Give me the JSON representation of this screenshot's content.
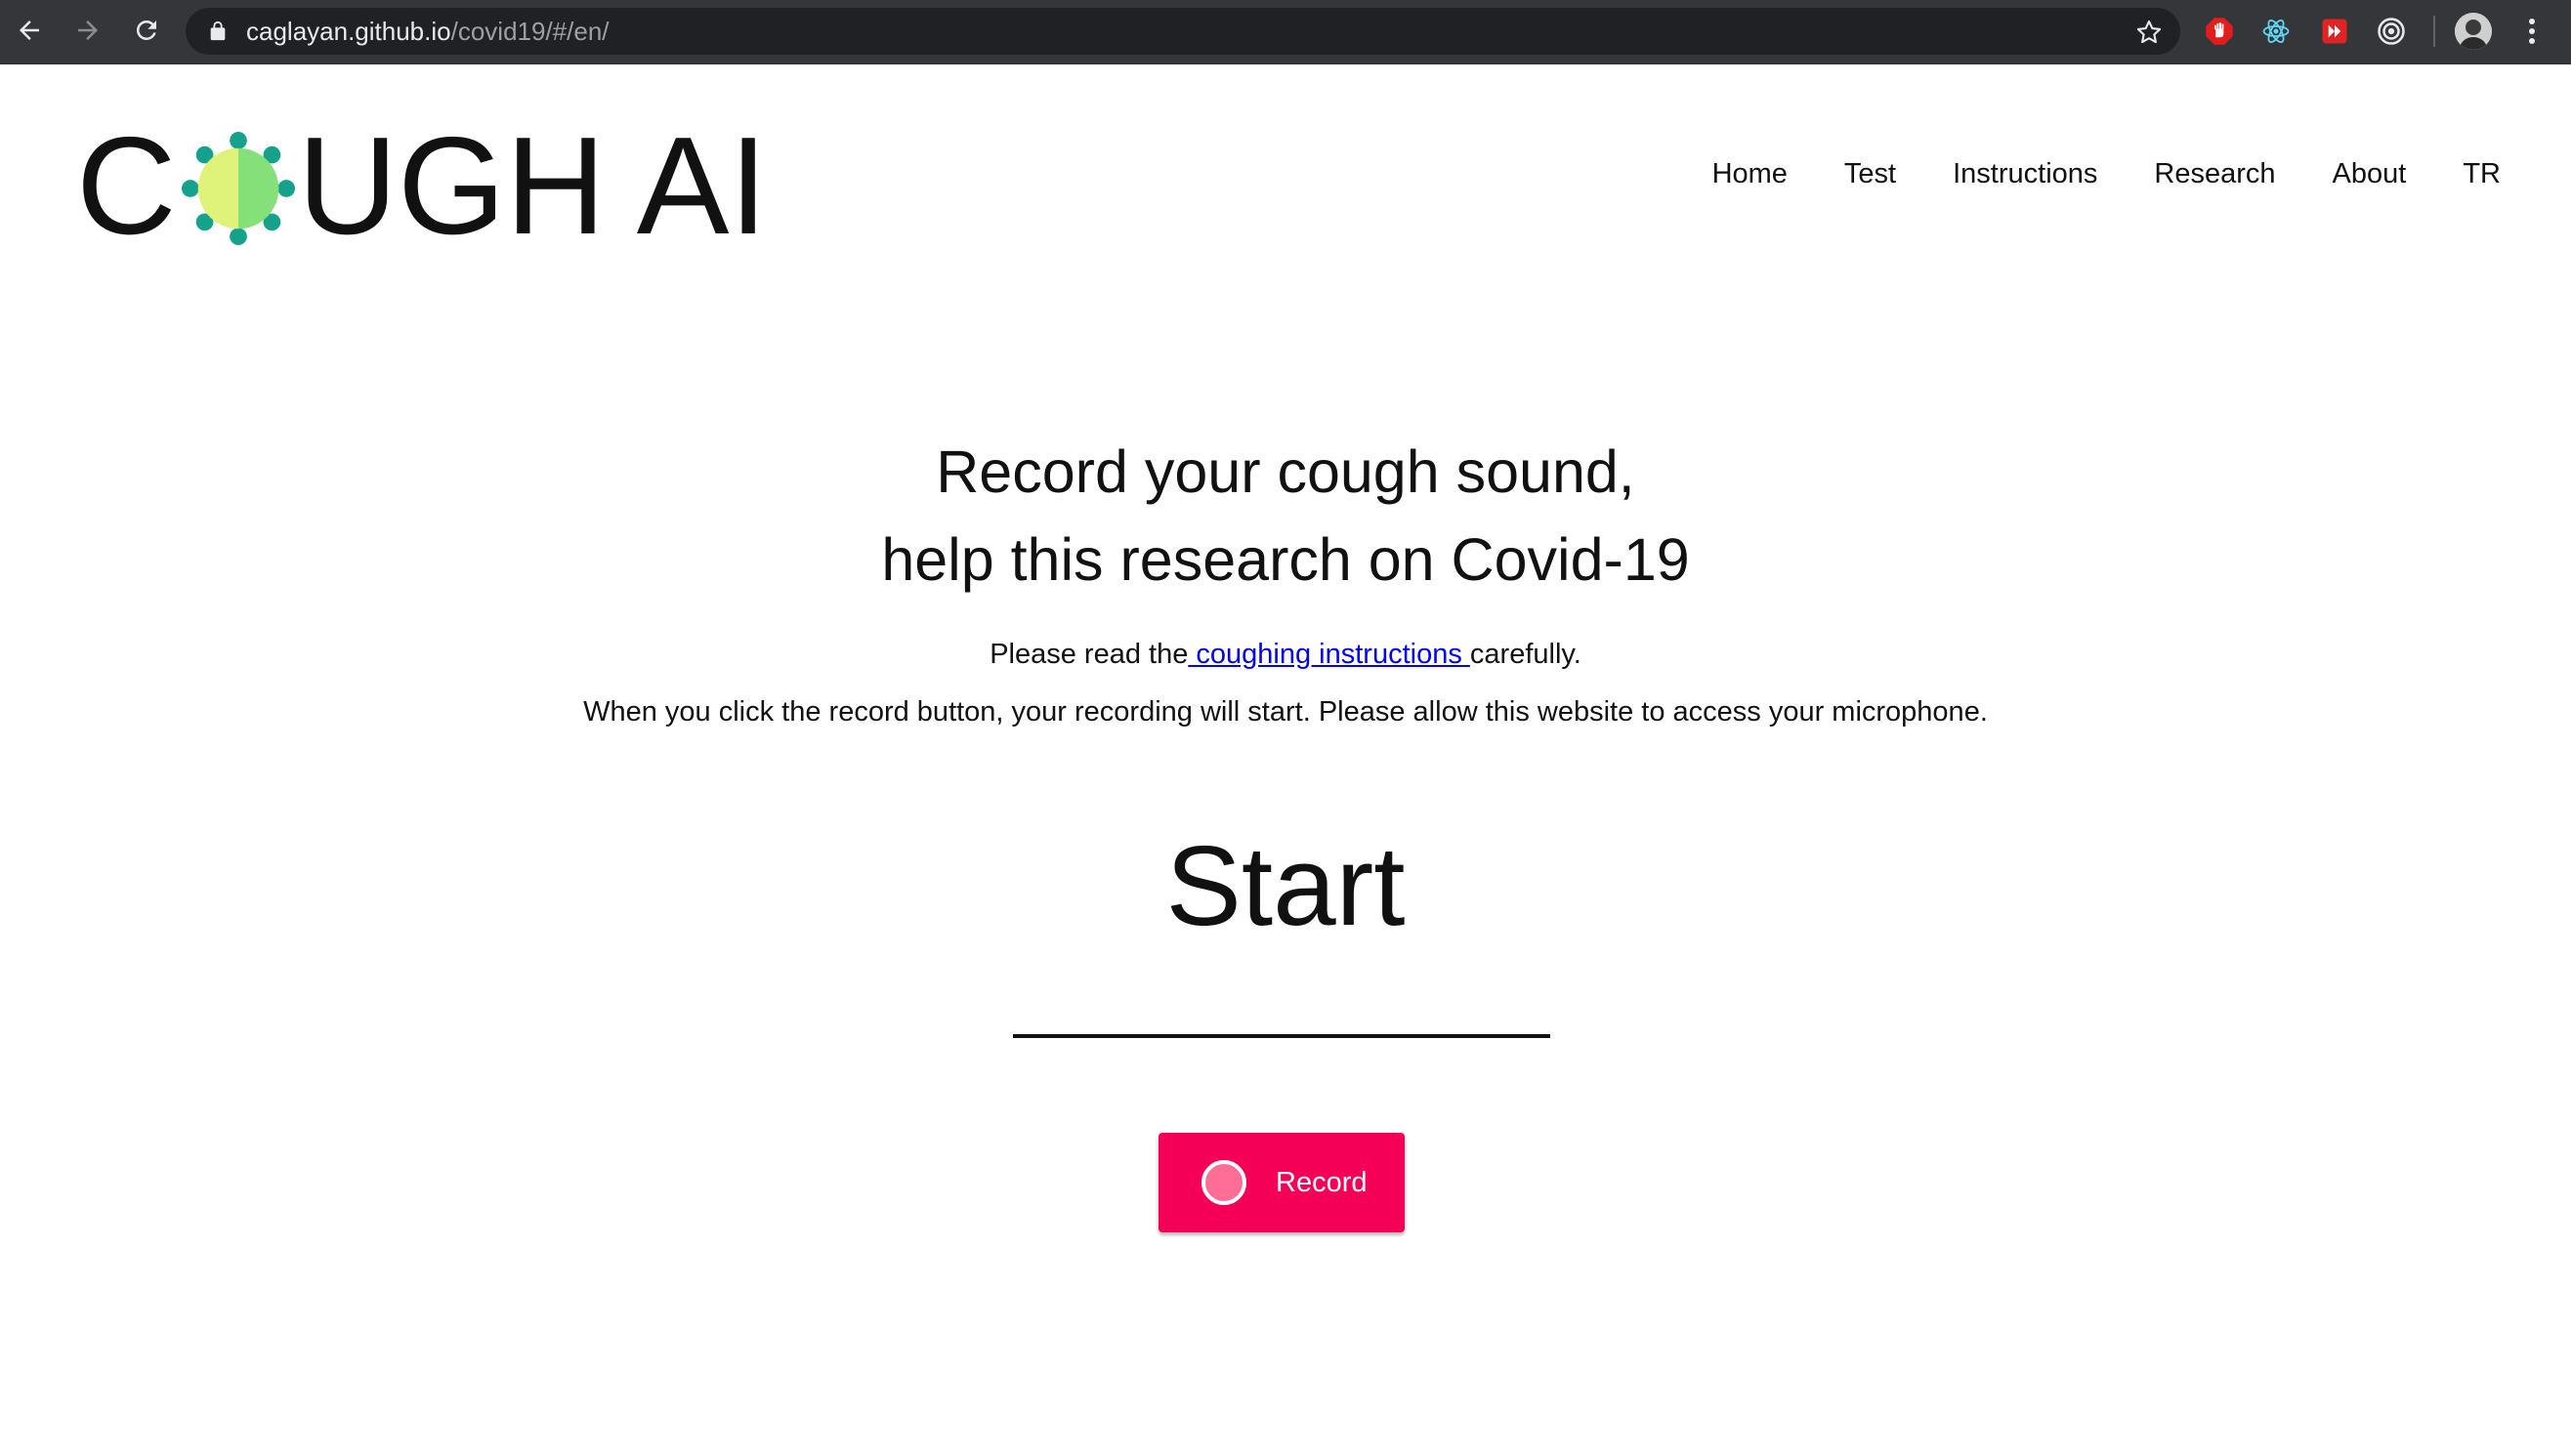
{
  "browser": {
    "url_host": "caglayan.github.io",
    "url_path": "/covid19/#/en/",
    "icons": [
      "back-arrow-icon",
      "forward-arrow-icon",
      "reload-icon",
      "lock-icon",
      "bookmark-star-icon",
      "adblock-hand-icon",
      "react-devtools-icon",
      "extension-red-icon",
      "extension-target-icon",
      "profile-avatar",
      "menu-dots-icon"
    ]
  },
  "logo": {
    "first_letter": "C",
    "rest": "UGH AI",
    "mark_colors": {
      "left": "#dff27a",
      "right": "#85e07a",
      "petals": "#15a18a"
    }
  },
  "nav": {
    "items": [
      {
        "label": "Home"
      },
      {
        "label": "Test"
      },
      {
        "label": "Instructions"
      },
      {
        "label": "Research"
      },
      {
        "label": "About"
      },
      {
        "label": "TR"
      }
    ]
  },
  "main": {
    "headline_line1": "Record your cough sound,",
    "headline_line2": "help this research on Covid-19",
    "instruction_prefix": "Please read the",
    "instruction_link": " coughing instructions ",
    "instruction_suffix": "carefully.",
    "instruction_line2": "When you click the record button, your recording will start. Please allow this website to access your microphone.",
    "status_title": "Start",
    "record_label": "Record"
  },
  "colors": {
    "accent": "#f50057",
    "link": "#0000ee",
    "chrome_bg": "#35363a"
  }
}
